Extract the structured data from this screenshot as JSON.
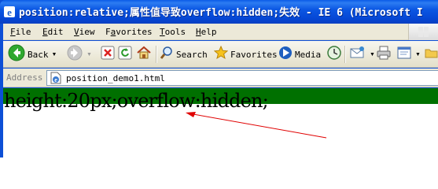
{
  "window": {
    "title": "position:relative;属性值导致overflow:hidden;失效 - IE 6 (Microsoft I"
  },
  "menu": {
    "items": [
      {
        "pre": "",
        "key": "F",
        "rest": "ile"
      },
      {
        "pre": "",
        "key": "E",
        "rest": "dit"
      },
      {
        "pre": "",
        "key": "V",
        "rest": "iew"
      },
      {
        "pre": "F",
        "key": "a",
        "rest": "vorites"
      },
      {
        "pre": "",
        "key": "T",
        "rest": "ools"
      },
      {
        "pre": "",
        "key": "H",
        "rest": "elp"
      }
    ]
  },
  "toolbar": {
    "back_label": "Back",
    "search_label": "Search",
    "favorites_label": "Favorites",
    "media_label": "Media"
  },
  "address": {
    "label": "Address",
    "value": "position_demo1.html"
  },
  "content": {
    "demo_text": "height:20px;overflow:hidden;",
    "band_color": "#007000",
    "arrow_color": "#e00000"
  }
}
